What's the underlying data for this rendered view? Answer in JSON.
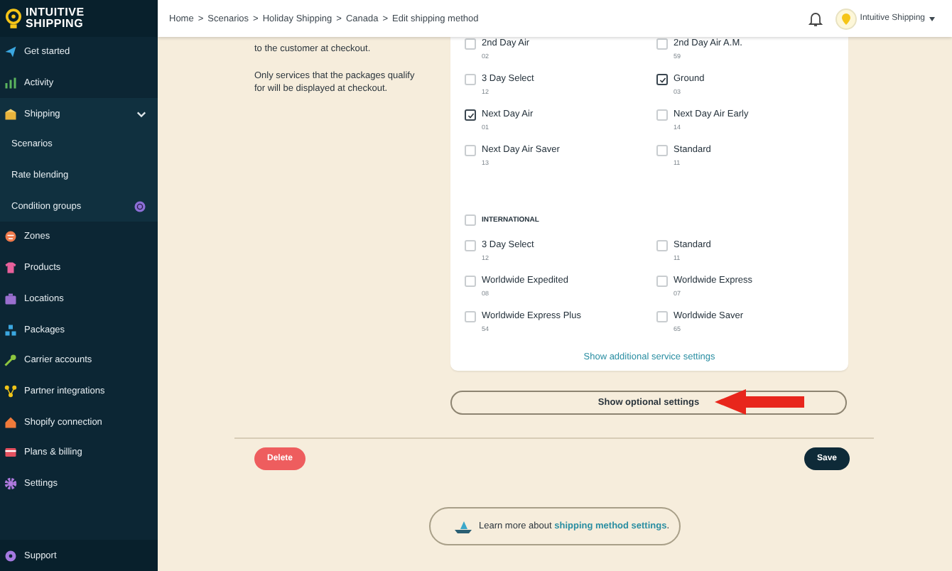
{
  "brand": {
    "line_1": "INTUITIVE",
    "line_2": "SHIPPING"
  },
  "sidebar": {
    "items": [
      {
        "label": "Get started"
      },
      {
        "label": "Activity"
      },
      {
        "label": "Shipping",
        "expanded": true,
        "children": [
          {
            "label": "Scenarios"
          },
          {
            "label": "Rate blending"
          },
          {
            "label": "Condition groups",
            "badge": true
          }
        ]
      },
      {
        "label": "Zones"
      },
      {
        "label": "Products"
      },
      {
        "label": "Locations"
      },
      {
        "label": "Packages"
      },
      {
        "label": "Carrier accounts"
      },
      {
        "label": "Partner integrations"
      },
      {
        "label": "Shopify connection"
      },
      {
        "label": "Plans & billing"
      },
      {
        "label": "Settings"
      }
    ],
    "footer": {
      "label": "Support"
    }
  },
  "header": {
    "breadcrumbs": [
      "Home",
      "Scenarios",
      "Holiday Shipping",
      "Canada",
      "Edit shipping method"
    ],
    "separator": ">",
    "account": "Intuitive Shipping"
  },
  "description": [
    "to the customer at checkout.",
    "Only services that the packages qualify for will be displayed at checkout."
  ],
  "service_groups": [
    {
      "services": [
        {
          "name": "2nd Day Air",
          "code": "02",
          "checked": false
        },
        {
          "name": "2nd Day Air A.M.",
          "code": "59",
          "checked": false
        },
        {
          "name": "3 Day Select",
          "code": "12",
          "checked": false
        },
        {
          "name": "Ground",
          "code": "03",
          "checked": true
        },
        {
          "name": "Next Day Air",
          "code": "01",
          "checked": true
        },
        {
          "name": "Next Day Air Early",
          "code": "14",
          "checked": false
        },
        {
          "name": "Next Day Air Saver",
          "code": "13",
          "checked": false
        },
        {
          "name": "Standard",
          "code": "11",
          "checked": false
        }
      ]
    },
    {
      "title": "INTERNATIONAL",
      "checked": false,
      "services": [
        {
          "name": "3 Day Select",
          "code": "12",
          "checked": false
        },
        {
          "name": "Standard",
          "code": "11",
          "checked": false
        },
        {
          "name": "Worldwide Expedited",
          "code": "08",
          "checked": false
        },
        {
          "name": "Worldwide Express",
          "code": "07",
          "checked": false
        },
        {
          "name": "Worldwide Express Plus",
          "code": "54",
          "checked": false
        },
        {
          "name": "Worldwide Saver",
          "code": "65",
          "checked": false
        }
      ]
    }
  ],
  "card_link": "Show additional service settings",
  "optional_button": "Show optional settings",
  "actions": {
    "delete": "Delete",
    "save": "Save"
  },
  "learn_more": {
    "text": "Learn more about ",
    "link": "shipping method settings",
    "end": "."
  }
}
